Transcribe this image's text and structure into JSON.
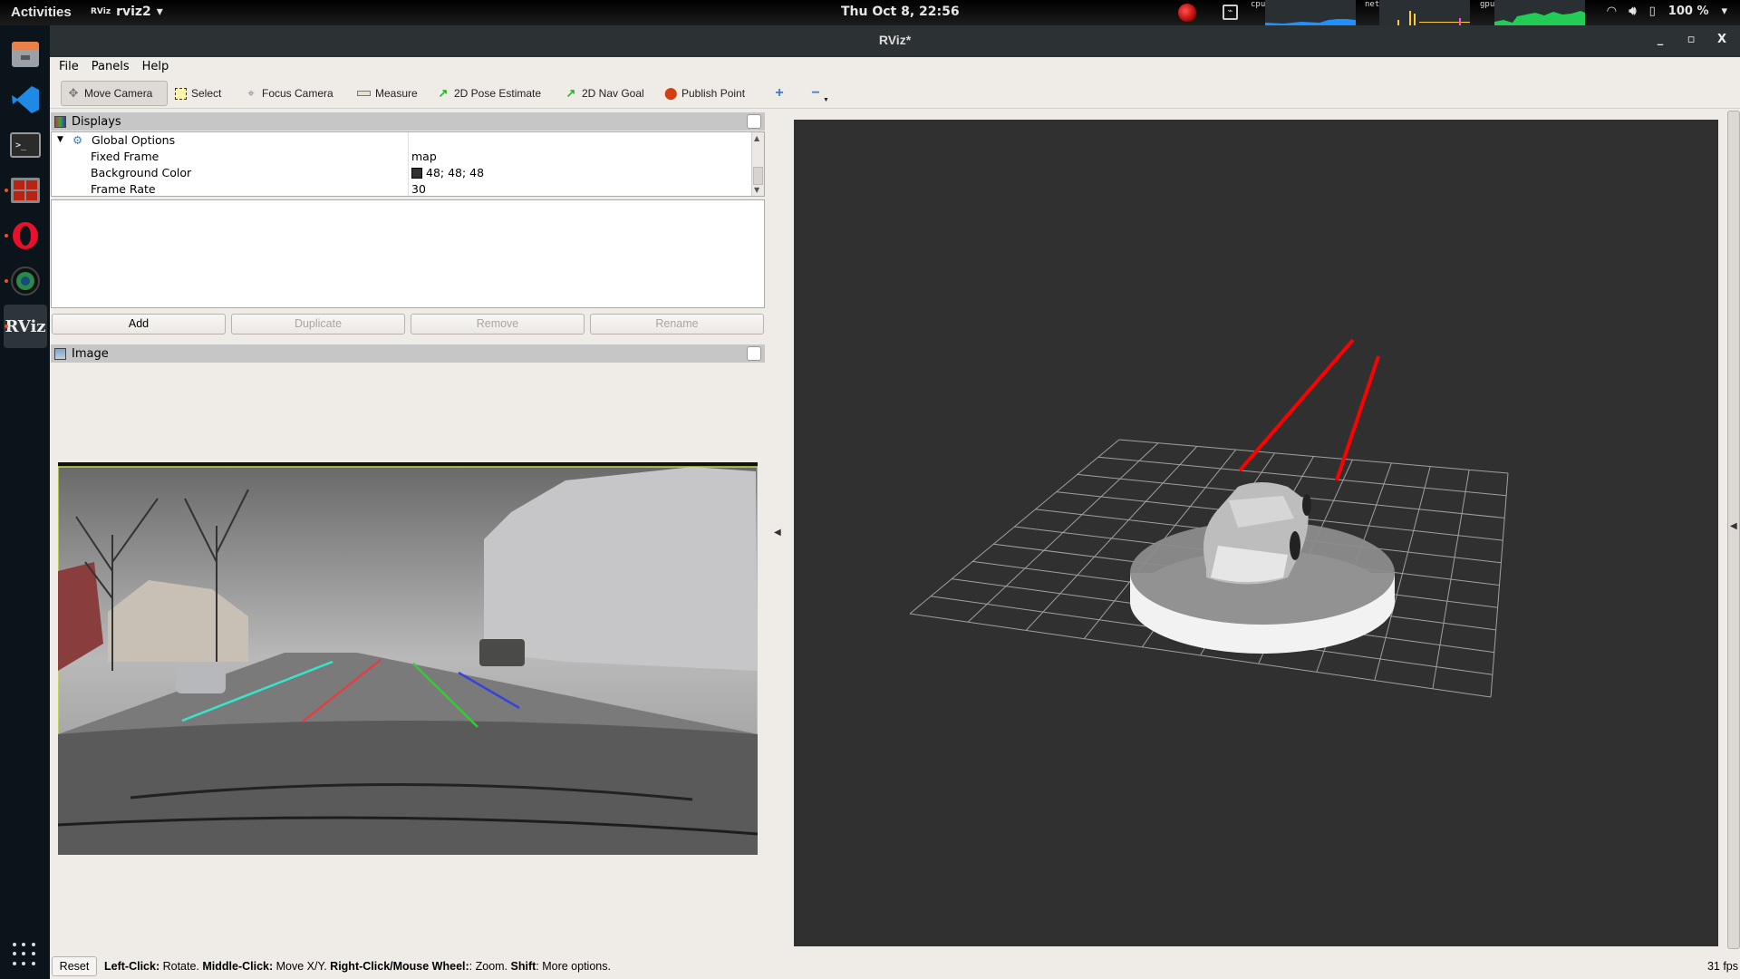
{
  "topbar": {
    "activities": "Activities",
    "app_name": "rviz2",
    "app_logo": "RViz",
    "clock": "Thu Oct  8, 22:56",
    "monitors": [
      {
        "label": "cpu",
        "color": "#1e90ff"
      },
      {
        "label": "net",
        "color": "#ffcc33"
      },
      {
        "label": "gpu",
        "color": "#22cc55"
      }
    ],
    "battery": "100 %",
    "icons": [
      "record-indicator-icon",
      "system-monitor-icon",
      "wifi-icon",
      "volume-icon",
      "battery-icon",
      "chevron-down-icon"
    ]
  },
  "dock": {
    "items": [
      {
        "name": "files",
        "running": false
      },
      {
        "name": "vscode",
        "running": false
      },
      {
        "name": "terminal",
        "running": false
      },
      {
        "name": "terminator",
        "running": true
      },
      {
        "name": "opera",
        "running": true
      },
      {
        "name": "camera",
        "running": true
      },
      {
        "name": "rviz",
        "running": true,
        "active": true
      }
    ],
    "show_apps": "show-applications"
  },
  "window": {
    "title": "RViz*",
    "controls": {
      "minimize": "_",
      "maximize": "▫",
      "close": "X"
    }
  },
  "menu": [
    "File",
    "Panels",
    "Help"
  ],
  "toolbar": {
    "tools": [
      {
        "label": "Move Camera",
        "icon": "move-camera-icon",
        "active": true
      },
      {
        "label": "Select",
        "icon": "select-icon",
        "active": false
      },
      {
        "label": "Focus Camera",
        "icon": "focus-camera-icon",
        "active": false
      },
      {
        "label": "Measure",
        "icon": "measure-icon",
        "active": false
      },
      {
        "label": "2D Pose Estimate",
        "icon": "pose-arrow-icon",
        "active": false
      },
      {
        "label": "2D Nav Goal",
        "icon": "nav-goal-arrow-icon",
        "active": false
      },
      {
        "label": "Publish Point",
        "icon": "map-pin-icon",
        "active": false
      }
    ],
    "add_tool": "+",
    "remove_tool": "−"
  },
  "displays_panel": {
    "title": "Displays",
    "tree": {
      "root": "Global Options",
      "rows": [
        {
          "key": "Fixed Frame",
          "value": "map"
        },
        {
          "key": "Background Color",
          "value": "48; 48; 48",
          "swatch": "#303030"
        },
        {
          "key": "Frame Rate",
          "value": "30"
        }
      ]
    },
    "buttons": [
      {
        "label": "Add",
        "enabled": true
      },
      {
        "label": "Duplicate",
        "enabled": false
      },
      {
        "label": "Remove",
        "enabled": false
      },
      {
        "label": "Rename",
        "enabled": false
      }
    ]
  },
  "image_panel": {
    "title": "Image",
    "lane_colors": [
      "#33e6cc",
      "#e04040",
      "#33cc33",
      "#3344dd"
    ]
  },
  "view3d": {
    "background": "#303030",
    "grid_color": "#a0a0a0",
    "marker_color": "#ff0000"
  },
  "status": {
    "reset": "Reset",
    "help": [
      {
        "b": "Left-Click:",
        "t": " Rotate. "
      },
      {
        "b": "Middle-Click:",
        "t": " Move X/Y. "
      },
      {
        "b": "Right-Click/Mouse Wheel:",
        "t": ": Zoom. "
      },
      {
        "b": "Shift",
        "t": ": More options."
      }
    ],
    "fps": "31 fps"
  }
}
